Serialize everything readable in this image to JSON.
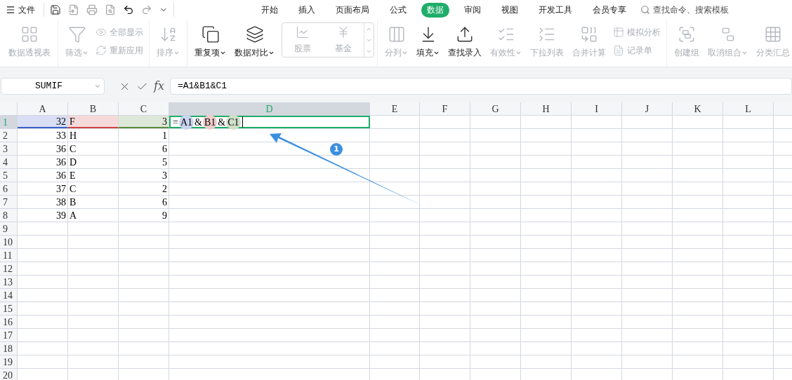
{
  "file_menu": {
    "label": "文件"
  },
  "tabs": [
    {
      "label": "开始",
      "selected": false
    },
    {
      "label": "插入",
      "selected": false
    },
    {
      "label": "页面布局",
      "selected": false
    },
    {
      "label": "公式",
      "selected": false
    },
    {
      "label": "数据",
      "selected": true
    },
    {
      "label": "审阅",
      "selected": false
    },
    {
      "label": "视图",
      "selected": false
    },
    {
      "label": "开发工具",
      "selected": false
    },
    {
      "label": "会员专享",
      "selected": false
    }
  ],
  "search": {
    "placeholder": "查找命令、搜索模板"
  },
  "ribbon_groups": [
    {
      "items": [
        {
          "kind": "large",
          "label": "数据透视表",
          "disabled": true,
          "dropdown": false
        }
      ]
    },
    {
      "items": [
        {
          "kind": "large",
          "label": "筛选",
          "disabled": true,
          "dropdown": true
        },
        {
          "kind": "stack",
          "entries": [
            {
              "label": "全部显示",
              "disabled": true
            },
            {
              "label": "重新应用",
              "disabled": true
            }
          ]
        }
      ]
    },
    {
      "items": [
        {
          "kind": "large",
          "label": "排序",
          "disabled": true,
          "dropdown": true
        }
      ]
    },
    {
      "items": [
        {
          "kind": "large",
          "label": "重复项",
          "disabled": false,
          "dropdown": true
        },
        {
          "kind": "large",
          "label": "数据对比",
          "disabled": false,
          "dropdown": true
        },
        {
          "kind": "gallery",
          "entries": [
            {
              "label": "股票",
              "disabled": true
            },
            {
              "label": "基金",
              "disabled": true
            }
          ]
        }
      ]
    },
    {
      "items": [
        {
          "kind": "large",
          "label": "分列",
          "disabled": true,
          "dropdown": true
        },
        {
          "kind": "large",
          "label": "填充",
          "disabled": false,
          "dropdown": true
        },
        {
          "kind": "large",
          "label": "查找录入",
          "disabled": false,
          "dropdown": false
        },
        {
          "kind": "large",
          "label": "有效性",
          "disabled": true,
          "dropdown": true
        },
        {
          "kind": "large",
          "label": "下拉列表",
          "disabled": true,
          "dropdown": false
        },
        {
          "kind": "large",
          "label": "合并计算",
          "disabled": true,
          "dropdown": false
        },
        {
          "kind": "stack",
          "entries": [
            {
              "label": "模拟分析",
              "disabled": true
            },
            {
              "label": "记录单",
              "disabled": true
            }
          ]
        }
      ]
    },
    {
      "items": [
        {
          "kind": "large",
          "label": "创建组",
          "disabled": true,
          "dropdown": false
        },
        {
          "kind": "large",
          "label": "取消组合",
          "disabled": true,
          "dropdown": true
        },
        {
          "kind": "large",
          "label": "分类汇总",
          "disabled": true,
          "dropdown": false
        }
      ]
    }
  ],
  "formula_bar": {
    "name_box": "SUMIF",
    "fx": "fx",
    "formula": "=A1&B1&C1"
  },
  "columns": [
    {
      "label": "A",
      "selected": false
    },
    {
      "label": "B",
      "selected": false
    },
    {
      "label": "C",
      "selected": false
    },
    {
      "label": "D",
      "selected": true
    },
    {
      "label": "E",
      "selected": false
    },
    {
      "label": "F",
      "selected": false
    },
    {
      "label": "G",
      "selected": false
    },
    {
      "label": "H",
      "selected": false
    },
    {
      "label": "I",
      "selected": false
    },
    {
      "label": "J",
      "selected": false
    },
    {
      "label": "K",
      "selected": false
    },
    {
      "label": "L",
      "selected": false
    }
  ],
  "rows": [
    {
      "number": "1",
      "selected": true,
      "cells": [
        {
          "text": "32",
          "kind": "number",
          "color": "#3b5fc9"
        },
        {
          "text": "F",
          "kind": "text",
          "color": "#d04444"
        },
        {
          "text": "3",
          "kind": "number",
          "color": "#5a8a3a"
        },
        {
          "kind": "editing",
          "tokens": [
            {
              "text": "="
            },
            {
              "text": "A1",
              "color": "#c8d4f0"
            },
            {
              "text": "&"
            },
            {
              "text": "B1",
              "color": "#f0cbcb"
            },
            {
              "text": "&"
            },
            {
              "text": "C1",
              "color": "#cfdec8"
            }
          ]
        }
      ]
    },
    {
      "number": "2",
      "selected": false,
      "cells": [
        {
          "text": "33",
          "kind": "number"
        },
        {
          "text": "H",
          "kind": "text"
        },
        {
          "text": "1",
          "kind": "number"
        }
      ]
    },
    {
      "number": "3",
      "selected": false,
      "cells": [
        {
          "text": "36",
          "kind": "number"
        },
        {
          "text": "C",
          "kind": "text"
        },
        {
          "text": "6",
          "kind": "number"
        }
      ]
    },
    {
      "number": "4",
      "selected": false,
      "cells": [
        {
          "text": "36",
          "kind": "number"
        },
        {
          "text": "D",
          "kind": "text"
        },
        {
          "text": "5",
          "kind": "number"
        }
      ]
    },
    {
      "number": "5",
      "selected": false,
      "cells": [
        {
          "text": "36",
          "kind": "number"
        },
        {
          "text": "E",
          "kind": "text"
        },
        {
          "text": "3",
          "kind": "number"
        }
      ]
    },
    {
      "number": "6",
      "selected": false,
      "cells": [
        {
          "text": "37",
          "kind": "number"
        },
        {
          "text": "C",
          "kind": "text"
        },
        {
          "text": "2",
          "kind": "number"
        }
      ]
    },
    {
      "number": "7",
      "selected": false,
      "cells": [
        {
          "text": "38",
          "kind": "number"
        },
        {
          "text": "B",
          "kind": "text"
        },
        {
          "text": "6",
          "kind": "number"
        }
      ]
    },
    {
      "number": "8",
      "selected": false,
      "cells": [
        {
          "text": "39",
          "kind": "number"
        },
        {
          "text": "A",
          "kind": "text"
        },
        {
          "text": "9",
          "kind": "number"
        }
      ]
    },
    {
      "number": "9",
      "selected": false,
      "cells": []
    },
    {
      "number": "10",
      "selected": false,
      "cells": []
    },
    {
      "number": "11",
      "selected": false,
      "cells": []
    },
    {
      "number": "12",
      "selected": false,
      "cells": []
    },
    {
      "number": "13",
      "selected": false,
      "cells": []
    },
    {
      "number": "14",
      "selected": false,
      "cells": []
    },
    {
      "number": "15",
      "selected": false,
      "cells": []
    },
    {
      "number": "16",
      "selected": false,
      "cells": []
    },
    {
      "number": "17",
      "selected": false,
      "cells": []
    },
    {
      "number": "18",
      "selected": false,
      "cells": []
    },
    {
      "number": "19",
      "selected": false,
      "cells": []
    },
    {
      "number": "20",
      "selected": false,
      "cells": []
    }
  ],
  "annotation": {
    "badge": "1"
  }
}
